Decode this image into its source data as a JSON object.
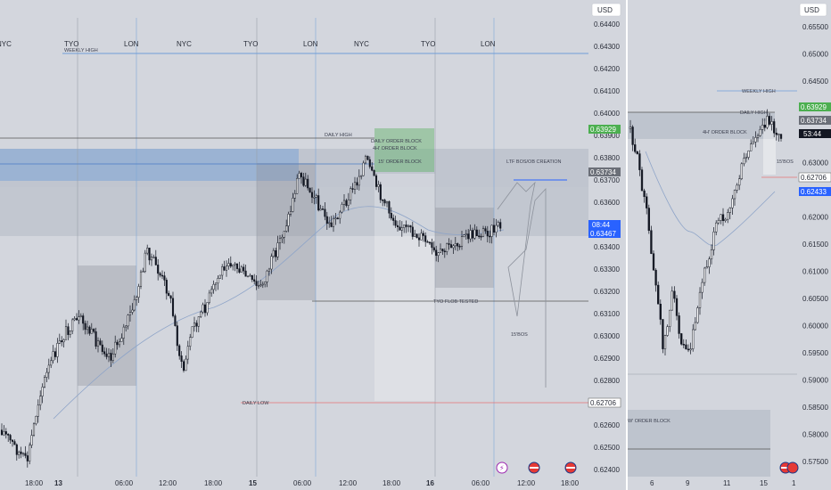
{
  "left_chart": {
    "currency": "USD",
    "price_ticks": [
      "0.64400",
      "0.64300",
      "0.64200",
      "0.64100",
      "0.64000",
      "0.63900",
      "0.63800",
      "0.63700",
      "0.63600",
      "0.63500",
      "0.63400",
      "0.63300",
      "0.63200",
      "0.63100",
      "0.63000",
      "0.62900",
      "0.62800",
      "0.62600",
      "0.62500",
      "0.62400"
    ],
    "time_ticks": [
      "18:00",
      "13",
      "06:00",
      "12:00",
      "18:00",
      "15",
      "06:00",
      "12:00",
      "18:00",
      "16",
      "06:00",
      "12:00",
      "18:00"
    ],
    "sessions": [
      {
        "label": "NYC",
        "color": "#f29a2e"
      },
      {
        "label": "TYO",
        "color": "#4caf50"
      },
      {
        "label": "LON",
        "color": "#2196f3"
      },
      {
        "label": "NYC",
        "color": "#f29a2e"
      },
      {
        "label": "TYO",
        "color": "#4caf50"
      },
      {
        "label": "LON",
        "color": "#2196f3"
      },
      {
        "label": "NYC",
        "color": "#f29a2e"
      },
      {
        "label": "TYO",
        "color": "#4caf50"
      },
      {
        "label": "LON",
        "color": "#2196f3"
      }
    ],
    "price_tags": {
      "green": "0.63929",
      "gray": "0.63734",
      "countdown": "08:44",
      "blue": "0.63467",
      "low": "0.62706"
    },
    "annotations": {
      "daily_high": "DAILY HIGH",
      "daily_order_block": "DAILY ORDER BLOCK",
      "order_block_4h": "4H' ORDER BLOCK",
      "order_block_15": "15' ORDER BLOCK",
      "ltf_bos": "LTF BOS/OB CREATION",
      "tested": "TYO FLOB TESTED",
      "bos_15": "15'BOS",
      "weekly_high": "WEEKLY HIGH",
      "low_line": "DAILY LOW"
    }
  },
  "right_chart": {
    "currency": "USD",
    "price_ticks": [
      "0.65500",
      "0.65000",
      "0.64500",
      "0.64000",
      "0.63500",
      "0.63000",
      "0.62500",
      "0.62000",
      "0.61500",
      "0.61000",
      "0.60500",
      "0.60000",
      "0.59500",
      "0.59000",
      "0.58500",
      "0.58000",
      "0.57500"
    ],
    "time_ticks": [
      "6",
      "9",
      "11",
      "15",
      "1"
    ],
    "price_tags": {
      "green": "0.63929",
      "gray": "0.63734",
      "countdown": "53:44",
      "white": "0.62706",
      "blue": "0.62433"
    },
    "annotations": {
      "daily_high": "DAILY HIGH",
      "order_block_4h": "4H' ORDER BLOCK",
      "bos_15": "15'BOS",
      "weekly_ob": "W' ORDER BLOCK",
      "weekly_high": "WEEKLY HIGH"
    }
  }
}
